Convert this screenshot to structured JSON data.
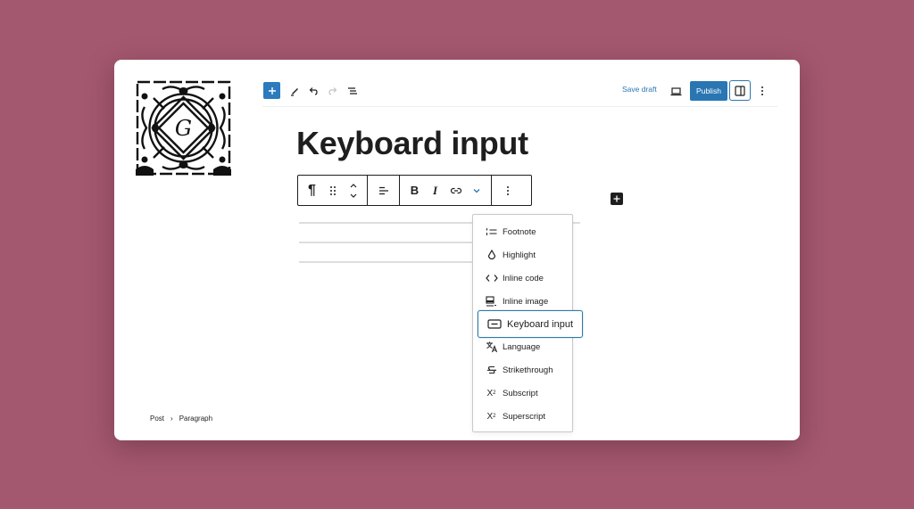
{
  "colors": {
    "background": "#a3586f",
    "accent": "#2a76b3",
    "text": "#1e1e1e"
  },
  "logo": {
    "letter": "G",
    "icon": "wordpress-gutenberg-logo"
  },
  "topbar": {
    "add_icon": "plus-icon",
    "tools_icon": "pencil-icon",
    "undo_icon": "undo-icon",
    "redo_icon": "redo-icon",
    "outline_icon": "list-view-icon",
    "save_draft_label": "Save draft",
    "preview_icon": "laptop-icon",
    "publish_label": "Publish",
    "settings_icon": "sidebar-toggle-icon",
    "options_icon": "more-vertical-icon"
  },
  "post": {
    "title": "Keyboard input"
  },
  "block_toolbar": {
    "items": [
      {
        "name": "paragraph-icon",
        "glyph": "¶"
      },
      {
        "name": "drag-handle-icon"
      },
      {
        "name": "move-up-down-icon"
      },
      {
        "name": "align-left-icon"
      },
      {
        "name": "bold-icon",
        "glyph": "B"
      },
      {
        "name": "italic-icon",
        "glyph": "I"
      },
      {
        "name": "link-icon"
      },
      {
        "name": "more-rich-text-icon"
      },
      {
        "name": "block-options-icon"
      }
    ]
  },
  "format_menu": {
    "items": [
      {
        "label": "Footnote",
        "icon": "footnote-icon"
      },
      {
        "label": "Highlight",
        "icon": "droplet-icon"
      },
      {
        "label": "Inline code",
        "icon": "code-icon"
      },
      {
        "label": "Inline image",
        "icon": "inline-image-icon"
      },
      {
        "label": "Keyboard input",
        "icon": "keyboard-icon",
        "active": true
      },
      {
        "label": "Language",
        "icon": "language-icon"
      },
      {
        "label": "Strikethrough",
        "icon": "strikethrough-icon"
      },
      {
        "label": "Subscript",
        "icon": "subscript-icon"
      },
      {
        "label": "Superscript",
        "icon": "superscript-icon"
      }
    ]
  },
  "breadcrumb": {
    "items": [
      "Post",
      "Paragraph"
    ],
    "separator": "›"
  }
}
